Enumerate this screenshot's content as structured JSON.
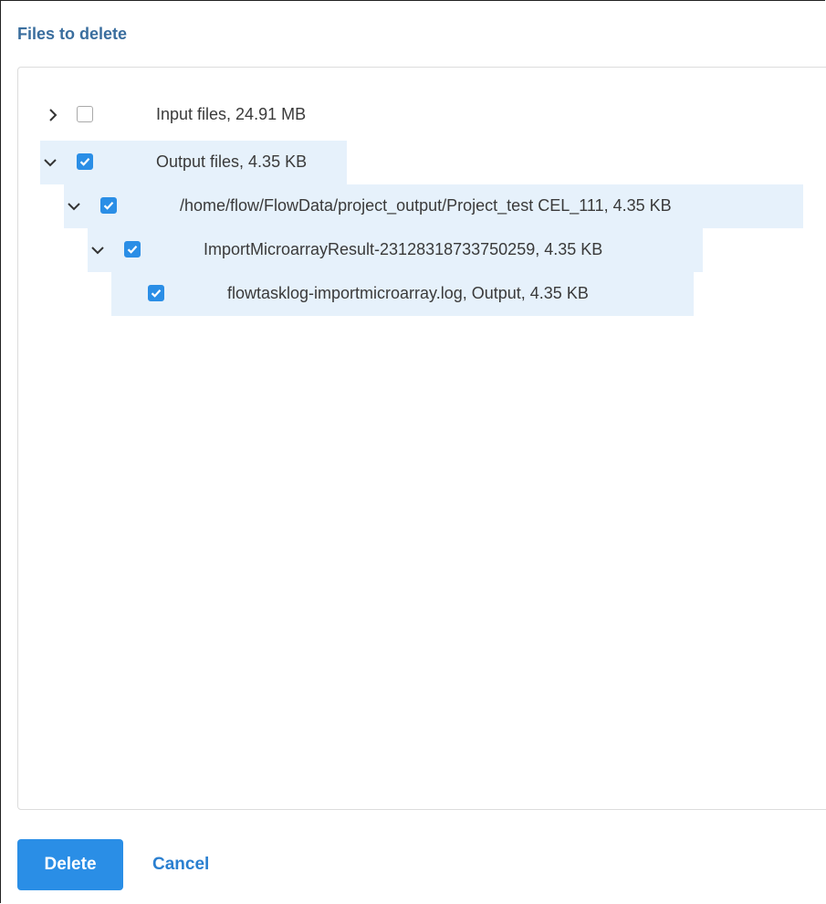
{
  "dialog": {
    "title": "Files to delete",
    "delete_label": "Delete",
    "cancel_label": "Cancel"
  },
  "tree": [
    {
      "label": "Input files, 24.91 MB",
      "level": 0,
      "expandable": true,
      "expanded": false,
      "checked": false
    },
    {
      "label": "Output files, 4.35 KB",
      "level": 0,
      "expandable": true,
      "expanded": true,
      "checked": true
    },
    {
      "label": "/home/flow/FlowData/project_output/Project_test CEL_111, 4.35 KB",
      "level": 1,
      "expandable": true,
      "expanded": true,
      "checked": true
    },
    {
      "label": "ImportMicroarrayResult-23128318733750259, 4.35 KB",
      "level": 2,
      "expandable": true,
      "expanded": true,
      "checked": true
    },
    {
      "label": "flowtasklog-importmicroarray.log, Output, 4.35 KB",
      "level": 3,
      "expandable": false,
      "expanded": false,
      "checked": true
    }
  ],
  "colors": {
    "accent": "#2a8ee6",
    "title": "#3a6e9e",
    "selected_row": "#e6f1fb"
  }
}
